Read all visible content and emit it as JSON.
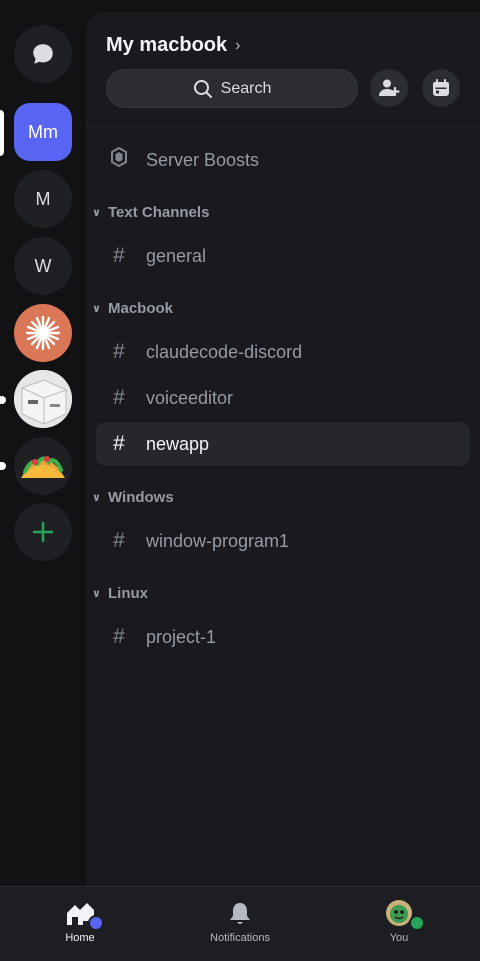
{
  "rail": {
    "servers": [
      {
        "name": "direct-messages",
        "label": ""
      },
      {
        "name": "server-my-macbook",
        "label": "Mm"
      },
      {
        "name": "server-m",
        "label": "M"
      },
      {
        "name": "server-w",
        "label": "W"
      }
    ]
  },
  "header": {
    "server_name": "My macbook",
    "search_label": "Search"
  },
  "channels": {
    "server_boosts": "Server Boosts",
    "categories": [
      {
        "name": "Text Channels",
        "channels": [
          "general"
        ]
      },
      {
        "name": "Macbook",
        "channels": [
          "claudecode-discord",
          "voiceeditor",
          "newapp"
        ]
      },
      {
        "name": "Windows",
        "channels": [
          "window-program1"
        ]
      },
      {
        "name": "Linux",
        "channels": [
          "project-1"
        ]
      }
    ],
    "selected": "newapp"
  },
  "bottom_nav": {
    "home": "Home",
    "notifications": "Notifications",
    "you": "You"
  },
  "colors": {
    "accent": "#5865f2",
    "online": "#23a55a",
    "claude_orange": "#d97757",
    "add_green": "#23a55a"
  }
}
